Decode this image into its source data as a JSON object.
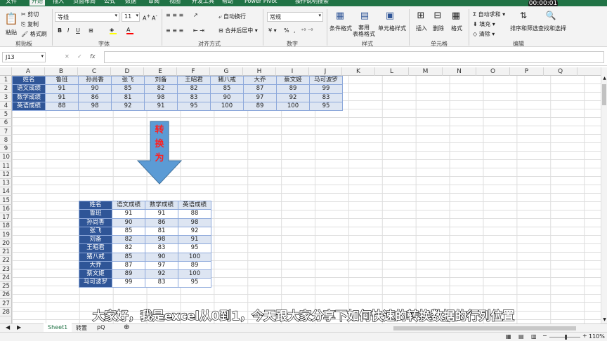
{
  "tabs": [
    "文件",
    "开始",
    "插入",
    "页面布局",
    "公式",
    "数据",
    "审阅",
    "视图",
    "开发工具",
    "帮助",
    "Power Pivot",
    "操作说明搜索"
  ],
  "timer": "00:00:01",
  "clipboard": {
    "paste": "粘贴",
    "cut": "剪切",
    "copy": "复制",
    "painter": "格式刷",
    "label": "剪贴板"
  },
  "font": {
    "name": "等线",
    "size": "11",
    "label": "字体",
    "bold": "B",
    "italic": "I",
    "underline": "U"
  },
  "alignment": {
    "wrap": "自动换行",
    "merge": "合并后居中",
    "label": "对齐方式"
  },
  "number": {
    "format": "常规",
    "percent": "%",
    "comma": ",",
    "label": "数字"
  },
  "styles": {
    "conditional": "条件格式",
    "table": "套用\n表格格式",
    "cell": "单元格样式",
    "label": "样式"
  },
  "cells": {
    "insert": "插入",
    "delete": "删除",
    "format": "格式",
    "label": "单元格"
  },
  "editing": {
    "autosum": "自动求和",
    "fill": "填充",
    "clear": "清除",
    "sort": "排序和筛选",
    "find": "查找和选择",
    "label": "编辑"
  },
  "namebox": "J13",
  "fx": "fx",
  "columns": [
    "A",
    "B",
    "C",
    "D",
    "E",
    "F",
    "G",
    "H",
    "I",
    "J",
    "K",
    "L",
    "M",
    "N",
    "O",
    "P",
    "Q"
  ],
  "rows": [
    "1",
    "2",
    "3",
    "4",
    "5",
    "6",
    "7",
    "8",
    "9",
    "10",
    "11",
    "12",
    "13",
    "14",
    "15",
    "16",
    "17",
    "18",
    "19",
    "20",
    "21",
    "22",
    "23",
    "24",
    "25",
    "26",
    "27",
    "28"
  ],
  "table1": [
    [
      "姓名",
      "鲁班",
      "孙尚香",
      "张飞",
      "刘备",
      "王昭君",
      "猪八戒",
      "大乔",
      "蔡文姬",
      "马可波罗"
    ],
    [
      "语文成绩",
      "91",
      "90",
      "85",
      "82",
      "82",
      "85",
      "87",
      "89",
      "99"
    ],
    [
      "数学成绩",
      "91",
      "86",
      "81",
      "98",
      "83",
      "90",
      "97",
      "92",
      "83"
    ],
    [
      "英语成绩",
      "88",
      "98",
      "92",
      "91",
      "95",
      "100",
      "89",
      "100",
      "95"
    ]
  ],
  "arrow_text": [
    "转",
    "换",
    "为"
  ],
  "table2": [
    [
      "姓名",
      "语文成绩",
      "数学成绩",
      "英语成绩"
    ],
    [
      "鲁班",
      "91",
      "91",
      "88"
    ],
    [
      "孙尚香",
      "90",
      "86",
      "98"
    ],
    [
      "张飞",
      "85",
      "81",
      "92"
    ],
    [
      "刘备",
      "82",
      "98",
      "91"
    ],
    [
      "王昭君",
      "82",
      "83",
      "95"
    ],
    [
      "猪八戒",
      "85",
      "90",
      "100"
    ],
    [
      "大乔",
      "87",
      "97",
      "89"
    ],
    [
      "蔡文姬",
      "89",
      "92",
      "100"
    ],
    [
      "马可波罗",
      "99",
      "83",
      "95"
    ]
  ],
  "sheets": [
    "Sheet1",
    "转置",
    "pQ"
  ],
  "zoom": "110%",
  "subtitle": "大家好，我是excel从0到1，今天跟大家分享下如何快速的转换数据的行列位置"
}
